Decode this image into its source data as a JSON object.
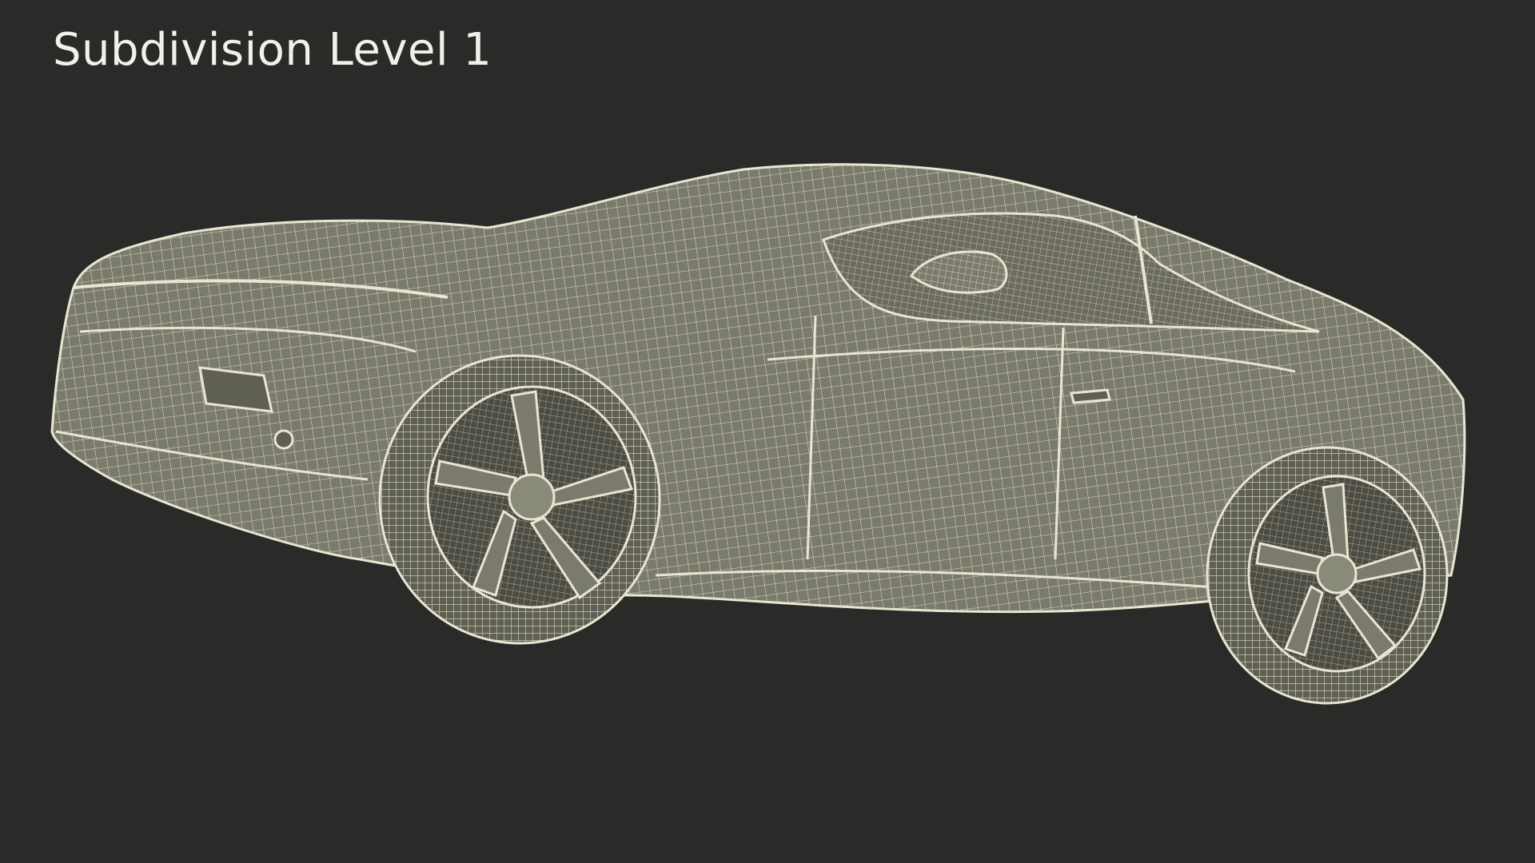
{
  "caption": {
    "title": "Subdivision Level 1"
  },
  "colors": {
    "background": "#2a2a29",
    "surface": "#7b7b6d",
    "surface_dark": "#5f5f53",
    "wire": "#e8e6d2",
    "caption": "#f1f1ec"
  },
  "viewport": {
    "subject": "car-wireframe",
    "wheels": [
      "front-wheel",
      "rear-wheel"
    ]
  }
}
